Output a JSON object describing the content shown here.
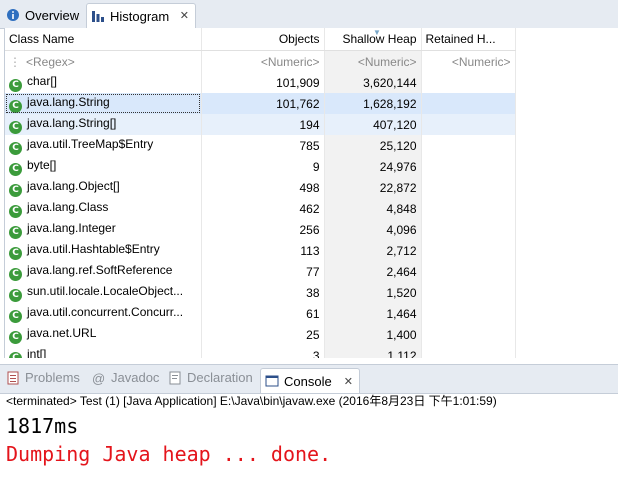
{
  "editor_tabs": [
    {
      "label": "Overview",
      "icon": "info-icon",
      "active": false
    },
    {
      "label": "Histogram",
      "icon": "histogram-icon",
      "active": true,
      "close": "✕"
    }
  ],
  "histogram": {
    "columns": [
      "Class Name",
      "Objects",
      "Shallow Heap",
      "Retained H..."
    ],
    "filter": {
      "name": "<Regex>",
      "objects": "<Numeric>",
      "shallow": "<Numeric>",
      "retained": "<Numeric>"
    },
    "class_icon_letter": "C",
    "rows": [
      {
        "name": "char[]",
        "objects": "101,909",
        "shallow": "3,620,144",
        "retained": ""
      },
      {
        "name": "java.lang.String",
        "objects": "101,762",
        "shallow": "1,628,192",
        "retained": ""
      },
      {
        "name": "java.lang.String[]",
        "objects": "194",
        "shallow": "407,120",
        "retained": ""
      },
      {
        "name": "java.util.TreeMap$Entry",
        "objects": "785",
        "shallow": "25,120",
        "retained": ""
      },
      {
        "name": "byte[]",
        "objects": "9",
        "shallow": "24,976",
        "retained": ""
      },
      {
        "name": "java.lang.Object[]",
        "objects": "498",
        "shallow": "22,872",
        "retained": ""
      },
      {
        "name": "java.lang.Class",
        "objects": "462",
        "shallow": "4,848",
        "retained": ""
      },
      {
        "name": "java.lang.Integer",
        "objects": "256",
        "shallow": "4,096",
        "retained": ""
      },
      {
        "name": "java.util.Hashtable$Entry",
        "objects": "113",
        "shallow": "2,712",
        "retained": ""
      },
      {
        "name": "java.lang.ref.SoftReference",
        "objects": "77",
        "shallow": "2,464",
        "retained": ""
      },
      {
        "name": "sun.util.locale.LocaleObject...",
        "objects": "38",
        "shallow": "1,520",
        "retained": ""
      },
      {
        "name": "java.util.concurrent.Concurr...",
        "objects": "61",
        "shallow": "1,464",
        "retained": ""
      },
      {
        "name": "java.net.URL",
        "objects": "25",
        "shallow": "1,400",
        "retained": ""
      },
      {
        "name": "int[]",
        "objects": "3",
        "shallow": "1,112",
        "retained": ""
      }
    ]
  },
  "bottom_tabs": [
    {
      "label": "Problems",
      "icon": "problems-icon",
      "active": false
    },
    {
      "label": "Javadoc",
      "icon": "javadoc-icon",
      "active": false
    },
    {
      "label": "Declaration",
      "icon": "declaration-icon",
      "active": false
    },
    {
      "label": "Console",
      "icon": "console-icon",
      "active": true,
      "close": "✕"
    }
  ],
  "console": {
    "terminated_line": "<terminated> Test (1) [Java Application] E:\\Java\\bin\\javaw.exe (2016年8月23日 下午1:01:59)",
    "output_line_1": "1817ms",
    "output_line_2": "Dumping Java heap ... done.",
    "colors": {
      "stdout": "#000000",
      "stderr": "#e4141b"
    }
  }
}
